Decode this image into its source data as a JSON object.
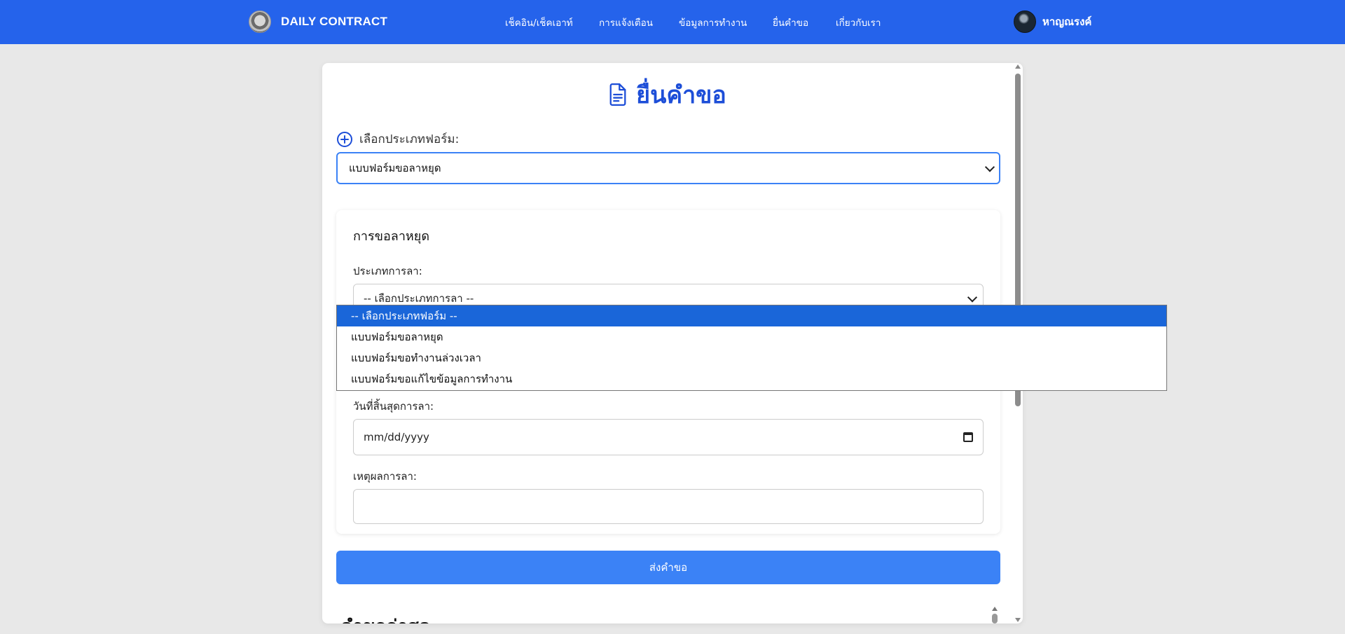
{
  "brand": {
    "name": "DAILY CONTRACT"
  },
  "nav": {
    "links": [
      {
        "label": "เช็คอิน/เช็คเอาท์"
      },
      {
        "label": "การแจ้งเตือน"
      },
      {
        "label": "ข้อมูลการทำงาน"
      },
      {
        "label": "ยื่นคำขอ"
      },
      {
        "label": "เกี่ยวกับเรา"
      }
    ],
    "user_name": "หาญณรงค์"
  },
  "page": {
    "title": "ยื่นคำขอ",
    "form_type_label": "เลือกประเภทฟอร์ม:",
    "form_type_selected": "แบบฟอร์มขอลาหยุด",
    "section_title": "การขอลาหยุด",
    "leave_type_label": "ประเภทการลา:",
    "leave_type_value": "-- เลือกประเภทการลา --",
    "end_date_label": "วันที่สิ้นสุดการลา:",
    "end_date_placeholder": "mm/dd/yyyy",
    "reason_label": "เหตุผลการลา:",
    "reason_value": "",
    "submit_label": "ส่งคำขอ",
    "recent_title": "คำขอล่าสุด"
  },
  "dropdown": {
    "options": [
      {
        "label": "-- เลือกประเภทฟอร์ม --",
        "highlighted": true
      },
      {
        "label": "แบบฟอร์มขอลาหยุด"
      },
      {
        "label": "แบบฟอร์มขอทำงานล่วงเวลา"
      },
      {
        "label": "แบบฟอร์มขอแก้ไขข้อมูลการทำงาน"
      }
    ]
  },
  "colors": {
    "navbar": "#2563eb",
    "title": "#1d4ed8",
    "button": "#3b82f6",
    "dropdown_highlight": "#1a66d9"
  }
}
